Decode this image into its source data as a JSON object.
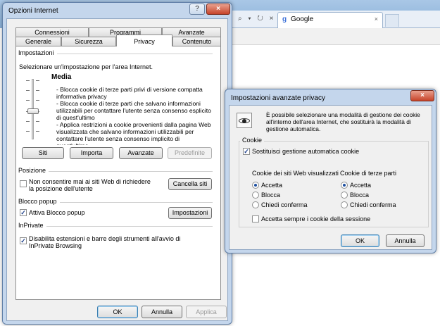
{
  "browser": {
    "tab_title": "Google",
    "tab_close": "×",
    "addr_icons": "⌕ ▾ ↻ ×"
  },
  "main_dialog": {
    "title": "Opzioni Internet",
    "help": "?",
    "close": "×",
    "tabs_back": [
      "Connessioni",
      "Programmi",
      "Avanzate"
    ],
    "tabs_front": [
      "Generale",
      "Sicurezza",
      "Privacy",
      "Contenuto"
    ],
    "settings": {
      "group_title": "Impostazioni",
      "instruction": "Selezionare un'impostazione per l'area Internet.",
      "level": "Media",
      "description": "- Blocca cookie di terze parti privi di versione compatta informativa privacy\n- Blocca cookie di terze parti che salvano informazioni utilizzabili per contattare l'utente senza consenso esplicito di quest'ultimo\n- Applica restrizioni a cookie provenienti dalla pagina Web visualizzata che salvano informazioni utilizzabili per contattare l'utente senza consenso implicito di quest'ultimo",
      "buttons": [
        "Siti",
        "Importa",
        "Avanzate",
        "Predefinite"
      ]
    },
    "position": {
      "group_title": "Posizione",
      "checkbox": "Non consentire mai ai siti Web di richiedere la posizione dell'utente",
      "button": "Cancella siti"
    },
    "popup": {
      "group_title": "Blocco popup",
      "checkbox": "Attiva Blocco popup",
      "button": "Impostazioni"
    },
    "inprivate": {
      "group_title": "InPrivate",
      "checkbox": "Disabilita estensioni e barre degli strumenti all'avvio di InPrivate Browsing"
    },
    "footer": {
      "ok": "OK",
      "cancel": "Annulla",
      "apply": "Applica"
    }
  },
  "advanced_dialog": {
    "title": "Impostazioni avanzate privacy",
    "close": "×",
    "intro": "È possibile selezionare una modalità di gestione dei cookie all'interno dell'area Internet, che sostituirà la modalità di gestione automatica.",
    "cookie_group": "Cookie",
    "override": "Sostituisci gestione automatica cookie",
    "first_party": {
      "header": "Cookie dei siti Web visualizzati",
      "options": [
        "Accetta",
        "Blocca",
        "Chiedi conferma"
      ]
    },
    "third_party": {
      "header": "Cookie di terze parti",
      "options": [
        "Accetta",
        "Blocca",
        "Chiedi conferma"
      ]
    },
    "session": "Accetta sempre i cookie della sessione",
    "ok": "OK",
    "cancel": "Annulla"
  }
}
